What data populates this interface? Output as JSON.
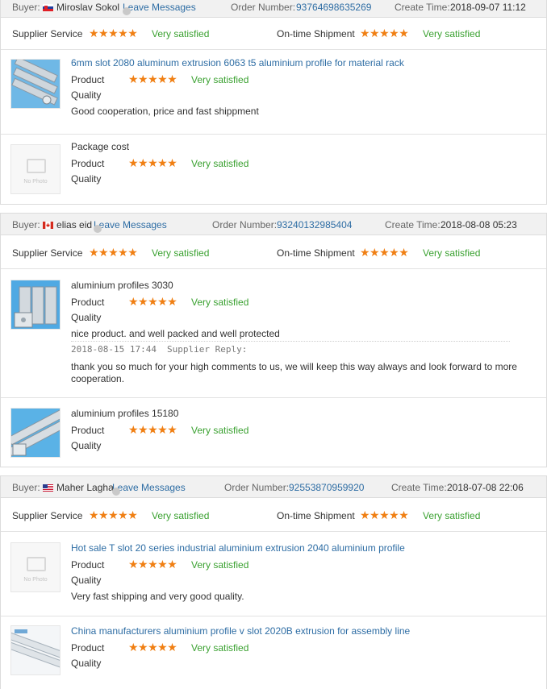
{
  "labels": {
    "buyer": "Buyer:",
    "leave_messages": "Leave Messages",
    "order_number": "Order Number:",
    "create_time": "Create Time:",
    "supplier_service": "Supplier Service",
    "ontime_shipment": "On-time Shipment",
    "product": "Product",
    "quality": "Quality",
    "very_satisfied": "Very satisfied",
    "stars": "★★★★★",
    "no_photo": "No Photo",
    "supplier_reply": "Supplier Reply:"
  },
  "colors": {
    "link": "#2e6da4",
    "stars": "#f07f13",
    "satisfied": "#3aa130",
    "header_bg": "#f1f1f1"
  },
  "reviews": [
    {
      "buyer_name": "Miroslav Sokol",
      "flag": "slovakia-flag-icon",
      "order_number": "93764698635269",
      "create_time": "2018-09-07 11:12",
      "items": [
        {
          "title": "6mm slot 2080 aluminum extrusion 6063 t5 aluminium profile for material rack",
          "comment": "Good cooperation, price and fast shippment",
          "thumb": "aluminum-profile-image"
        },
        {
          "title": "Package cost",
          "thumb": "no-photo-placeholder"
        }
      ]
    },
    {
      "buyer_name": "elias eid",
      "flag": "canada-flag-icon",
      "order_number": "93240132985404",
      "create_time": "2018-08-08 05:23",
      "items": [
        {
          "title": "aluminium profiles 3030",
          "comment": "nice product. and well packed and well protected",
          "reply_time": "2018-08-15 17:44",
          "reply_text_1": "thank you so much for your high comments to us, we will keep this way always and look forward to more",
          "reply_text_2": "cooperation.",
          "thumb": "aluminum-profile-image"
        },
        {
          "title": "aluminium profiles 15180",
          "thumb": "aluminum-profile-image"
        }
      ]
    },
    {
      "buyer_name": "Maher Lagha",
      "flag": "usa-flag-icon",
      "order_number": "92553870959920",
      "create_time": "2018-07-08 22:06",
      "items": [
        {
          "title": "Hot sale T slot 20 series industrial aluminium extrusion 2040 aluminium profile",
          "comment": "Very fast shipping and very good quality.",
          "thumb": "no-photo-placeholder"
        },
        {
          "title": "China manufacturers aluminium profile v slot 2020B extrusion for assembly line",
          "thumb": "aluminum-profile-image"
        }
      ]
    }
  ]
}
